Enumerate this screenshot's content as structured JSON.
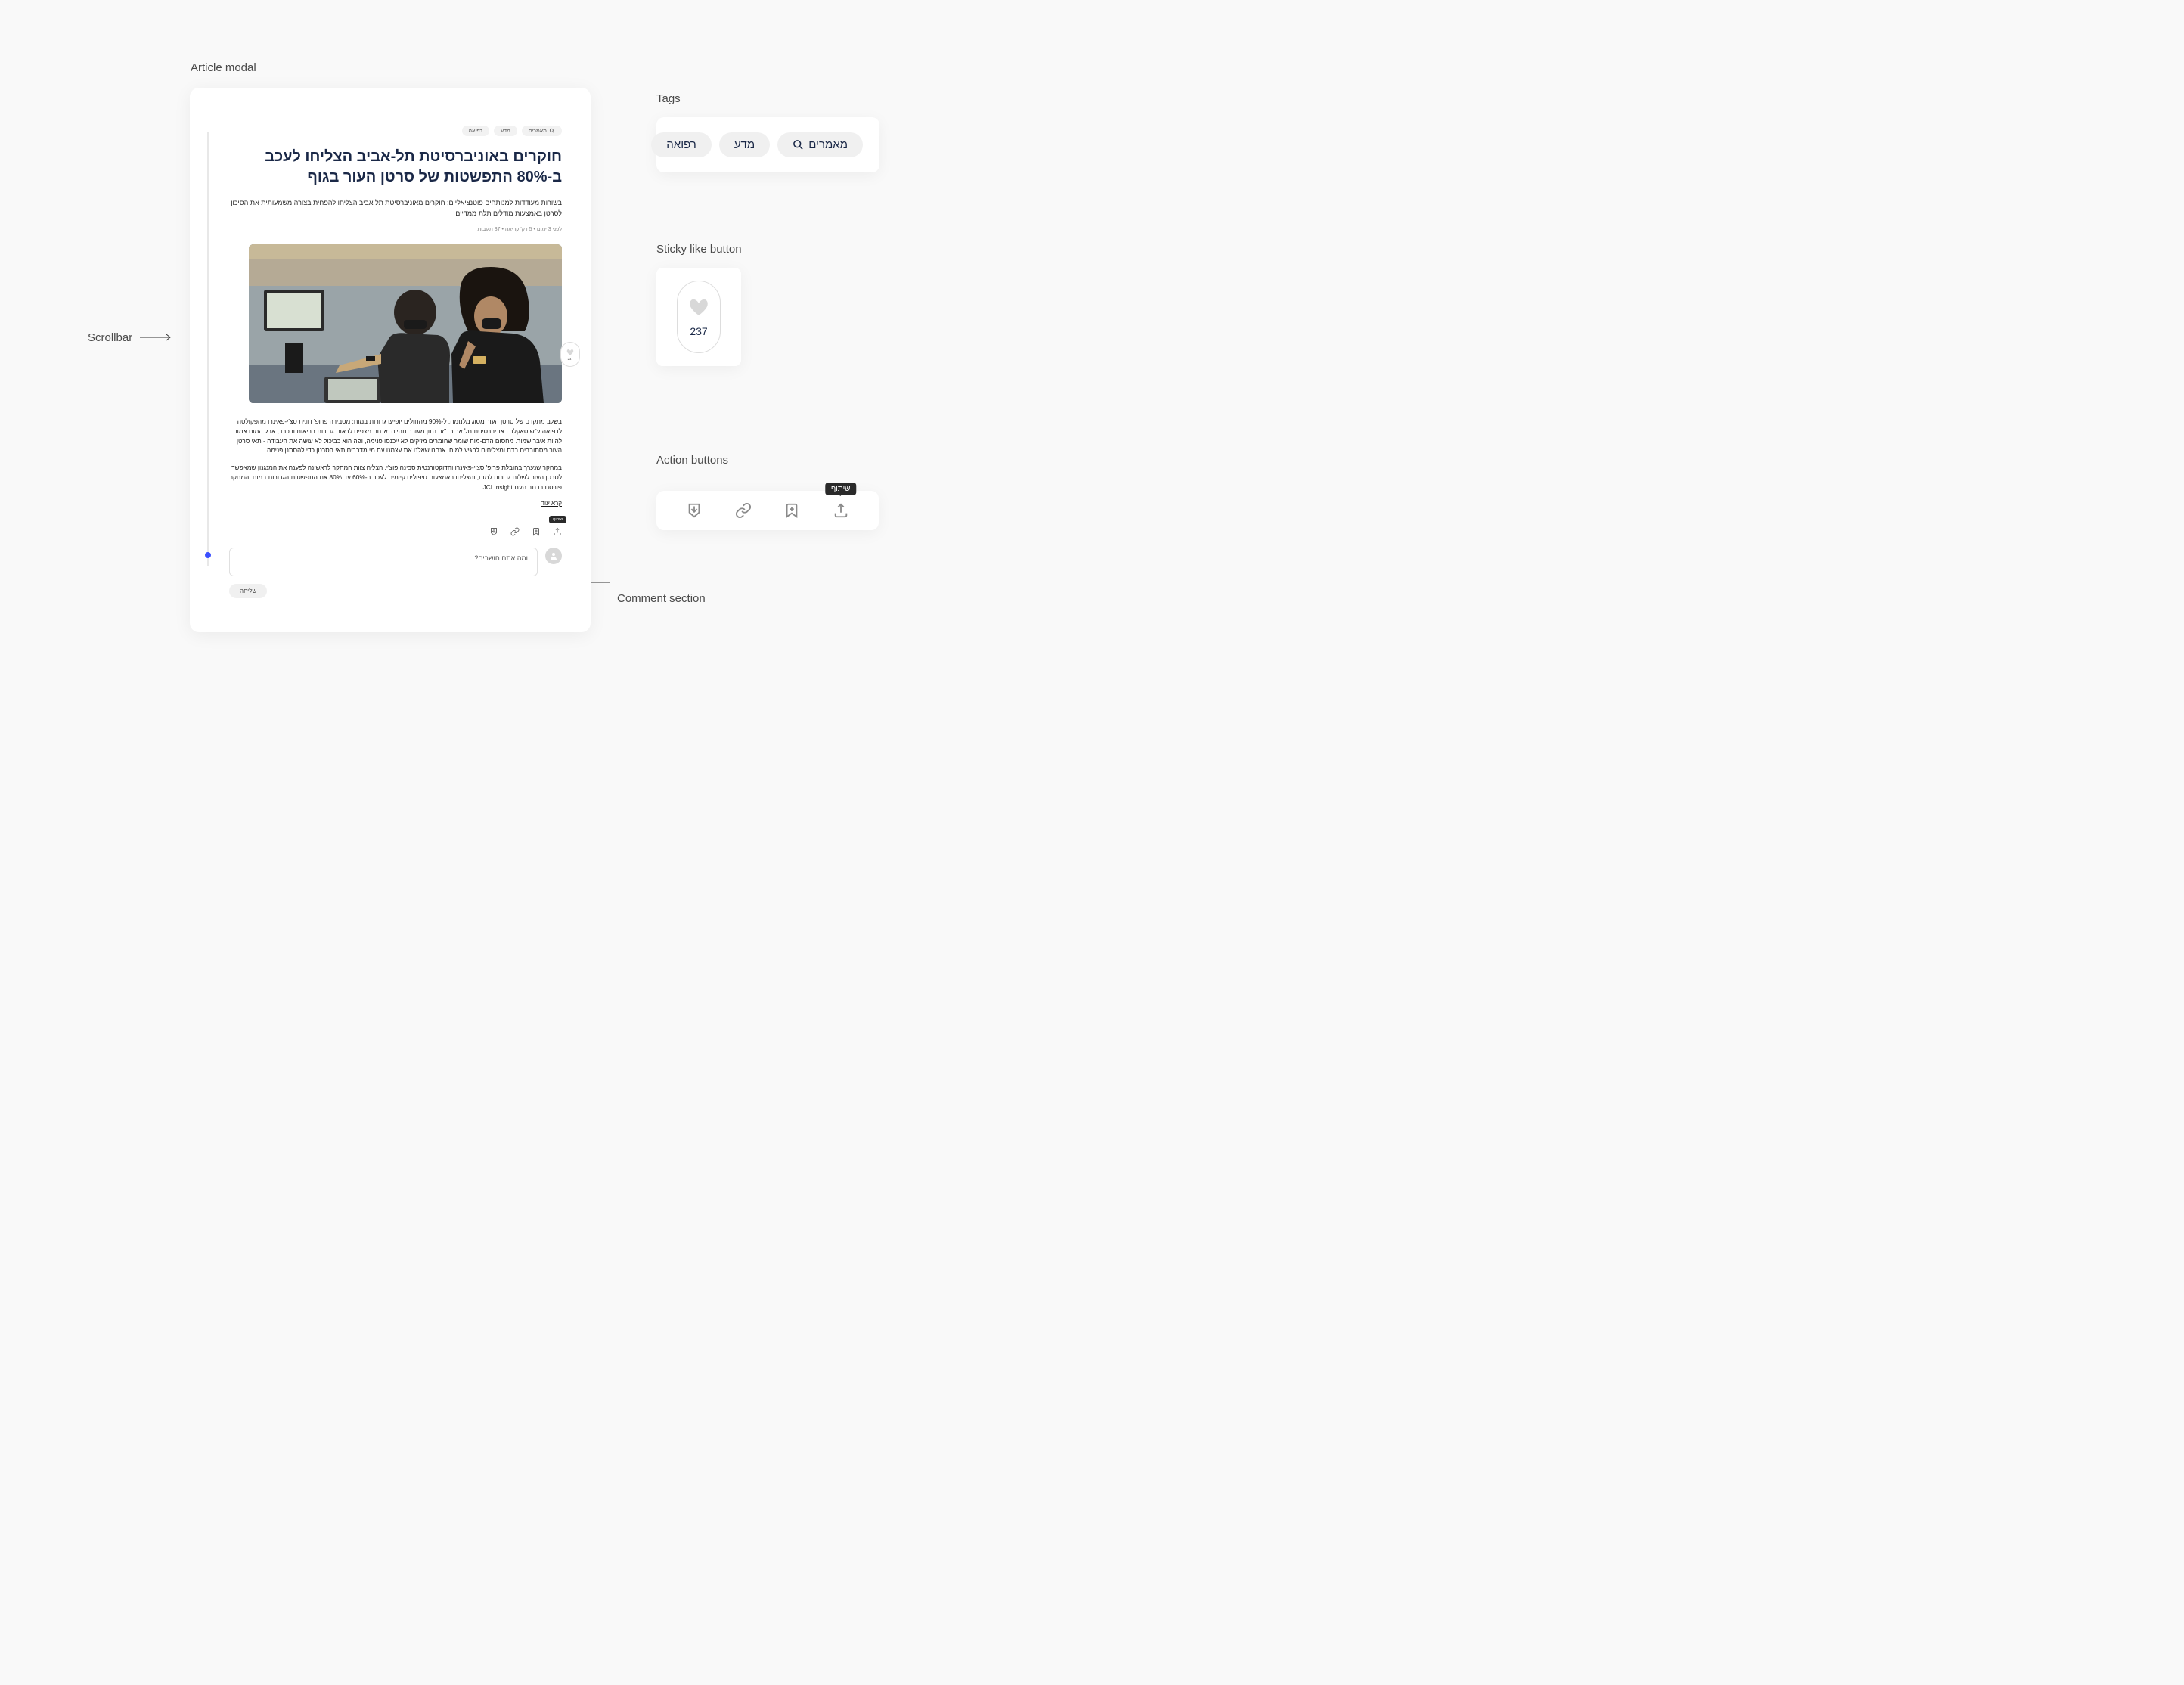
{
  "labels": {
    "article_modal": "Article modal",
    "tags": "Tags",
    "sticky_like": "Sticky like button",
    "action_buttons": "Action buttons",
    "comment_section": "Comment section",
    "scrollbar": "Scrollbar"
  },
  "article": {
    "tags": {
      "articles": "מאמרים",
      "science": "מדע",
      "medicine": "רפואה"
    },
    "title": "חוקרים באוניברסיטת תל-אביב הצליחו לעכב ב-80% התפשטות של סרטן העור בגוף",
    "subtitle": "בשורות מעודדות למנותחים פוטנציאליים: חוקרים מאוניברסיטת תל אביב הצליחו להפחית בצורה משמעותית את הסיכון לסרטן באמצעות מודלים תלת ממדיים",
    "meta": "לפני 3 ימים   •   5 דק' קריאה   •   37 תגובות",
    "body_p1": "בשלב מתקדם של סרטן העור מסוג מלנומה, ל-90% מהחולים יופיעו גרורות במוח; מסבירה פרופ' רונית סצ'י-פאינרו מהפקולטה לרפואה ע\"ש סאקלר באוניברסיטת תל אביב. \"זה נתון מעורר תהייה. אנחנו מצפים לראות גרורות בריאות ובכבד, אבל המוח אמור להיות איבר שמור. מחסום הדם-מוח שומר שחומרים מזיקים לא ייכנסו פנימה, ופה הוא כביכול לא עושה את העבודה - תאי סרטן העור מסתובבים בדם ומצליחים להגיע למוח. אנחנו שאלנו את עצמנו עם מי מדברים תאי הסרטן כדי להסתנן פנימה.",
    "body_p2": "במחקר שנערך בהובלת פרופ' סצ'י-פאינרו והדוקטורנטית סבינה פוצ'י, הצליח צוות המחקר לראשונה לפענח את המנגנון שמאפשר לסרטן העור לשלוח גרורות למוח, והצליחו באמצעות טיפולים קיימים לעכב ב-60% עד 80% את התפשטות הגרורות במוח. המחקר פורסם בכתב העת JCI Insight.",
    "read_more": "קרא עוד",
    "like_count": "237"
  },
  "comment": {
    "placeholder": "ומה אתם חושבים?",
    "send": "שליחה"
  },
  "tags_card": {
    "articles": "מאמרים",
    "science": "מדע",
    "medicine": "רפואה"
  },
  "sticky_like": {
    "count": "237"
  },
  "tooltip": {
    "share": "שיתוף"
  }
}
